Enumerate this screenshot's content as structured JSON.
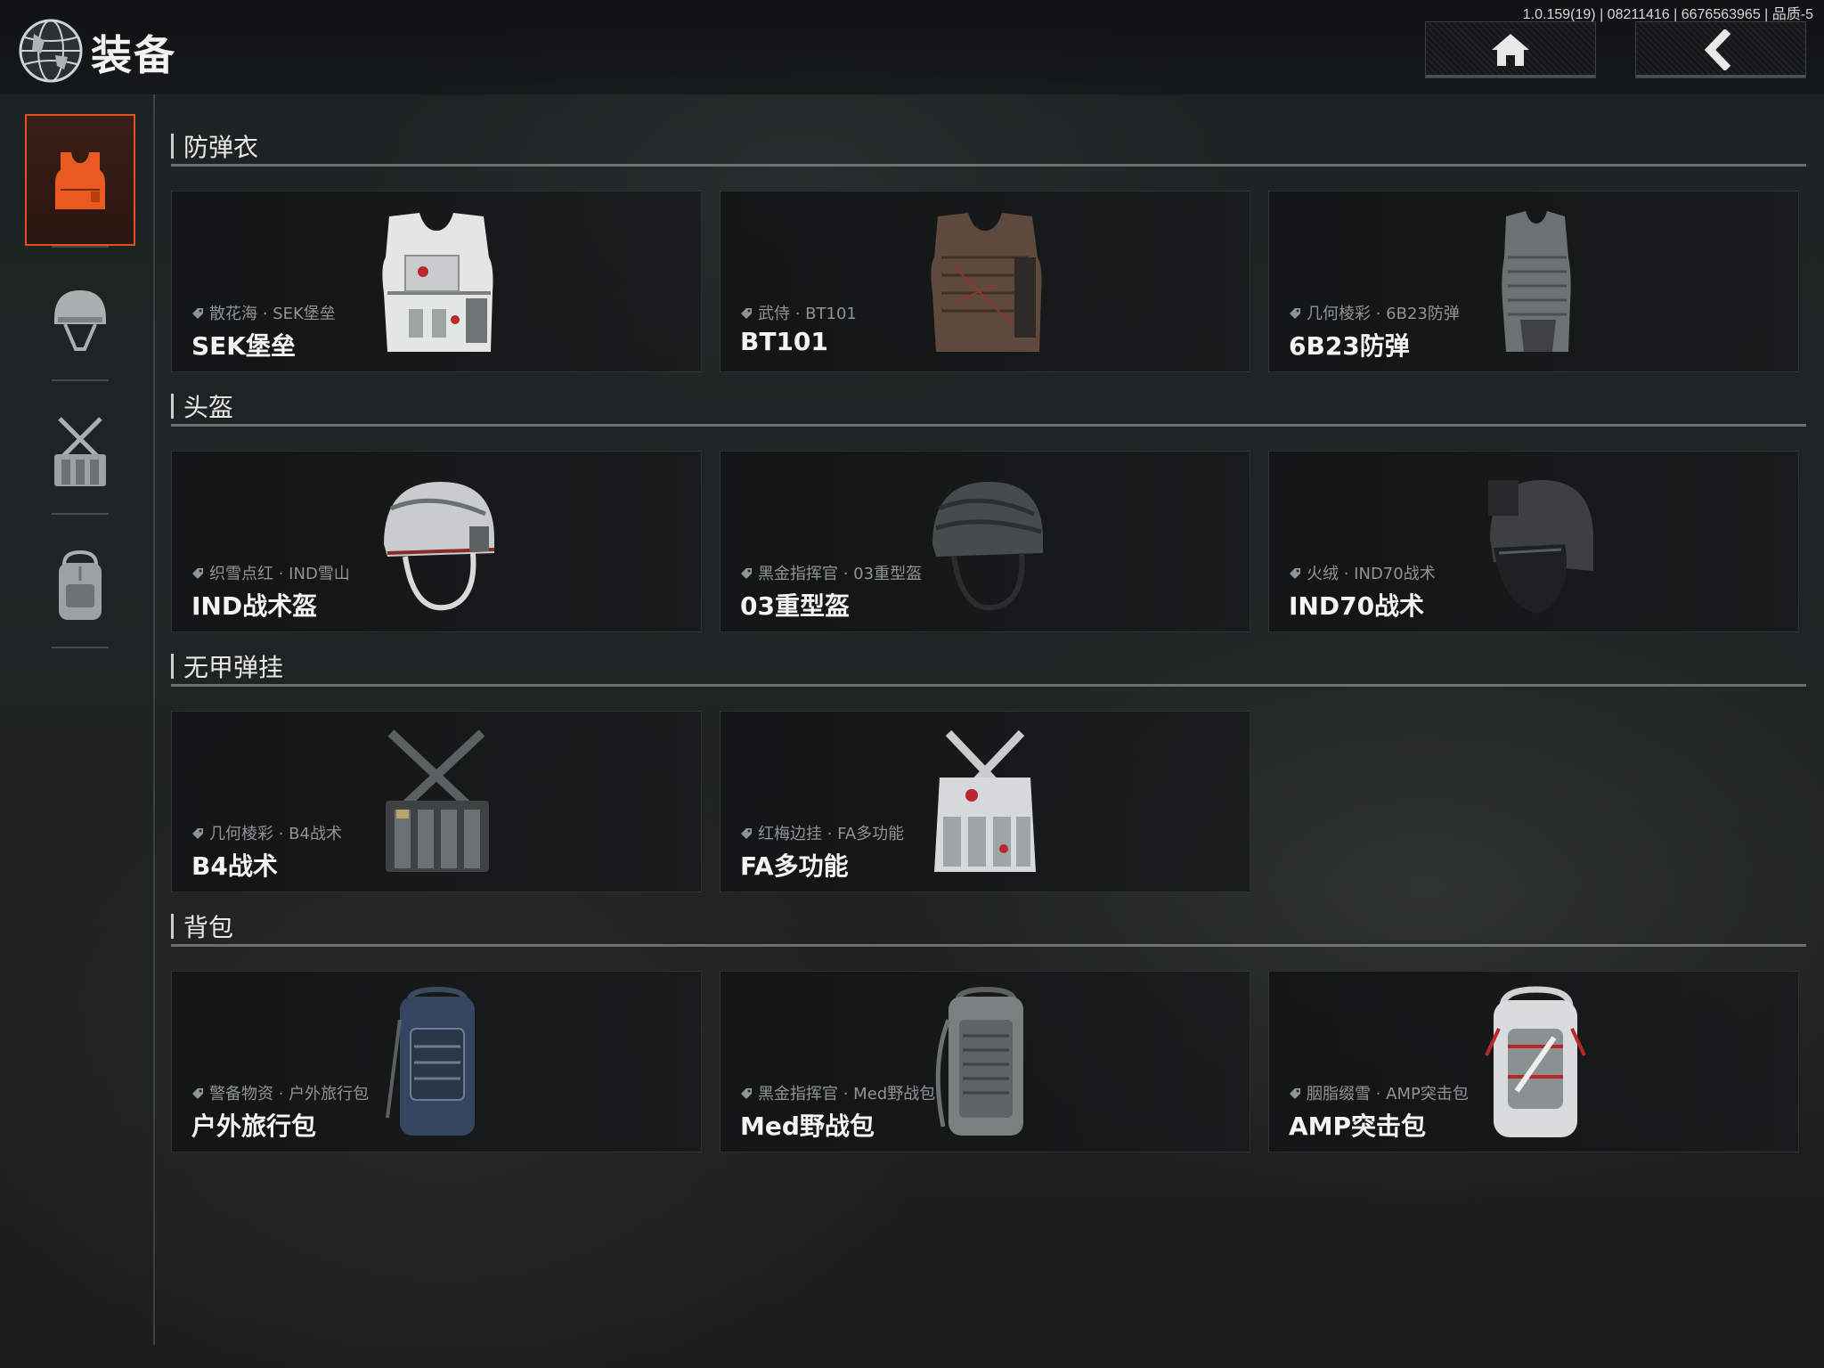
{
  "header": {
    "title": "装备",
    "version_info": "1.0.159(19) | 08211416 | 6676563965 | 品质-5"
  },
  "nav": {
    "home_icon": "home-icon",
    "back_icon": "chevron-left-icon"
  },
  "sidebar": {
    "accent_color": "#e1521d",
    "items": [
      {
        "icon": "vest-icon",
        "active": true
      },
      {
        "icon": "helmet-icon",
        "active": false
      },
      {
        "icon": "chest-rig-icon",
        "active": false
      },
      {
        "icon": "backpack-icon",
        "active": false
      }
    ]
  },
  "sections": [
    {
      "title": "防弹衣",
      "items": [
        {
          "skin": "散花海 · SEK堡垒",
          "name": "SEK堡垒",
          "icon": "vest-white-icon"
        },
        {
          "skin": "武侍 · BT101",
          "name": "BT101",
          "icon": "vest-brown-icon"
        },
        {
          "skin": "几何棱彩 · 6B23防弹",
          "name": "6B23防弹",
          "icon": "vest-grey-icon"
        }
      ]
    },
    {
      "title": "头盔",
      "items": [
        {
          "skin": "织雪点红 · IND雪山",
          "name": "IND战术盔",
          "icon": "helmet-white-icon"
        },
        {
          "skin": "黑金指挥官 · 03重型盔",
          "name": "03重型盔",
          "icon": "helmet-dark-icon"
        },
        {
          "skin": "火绒 · IND70战术",
          "name": "IND70战术",
          "icon": "helmet-visor-icon"
        }
      ]
    },
    {
      "title": "无甲弹挂",
      "items": [
        {
          "skin": "几何棱彩 · B4战术",
          "name": "B4战术",
          "icon": "chest-rig-dark-icon"
        },
        {
          "skin": "红梅边挂 · FA多功能",
          "name": "FA多功能",
          "icon": "chest-rig-white-icon"
        }
      ]
    },
    {
      "title": "背包",
      "items": [
        {
          "skin": "警备物资 · 户外旅行包",
          "name": "户外旅行包",
          "icon": "backpack-blue-icon"
        },
        {
          "skin": "黑金指挥官 · Med野战包",
          "name": "Med野战包",
          "icon": "backpack-grey-icon"
        },
        {
          "skin": "胭脂缀雪 · AMP突击包",
          "name": "AMP突击包",
          "icon": "backpack-white-icon"
        }
      ]
    }
  ]
}
